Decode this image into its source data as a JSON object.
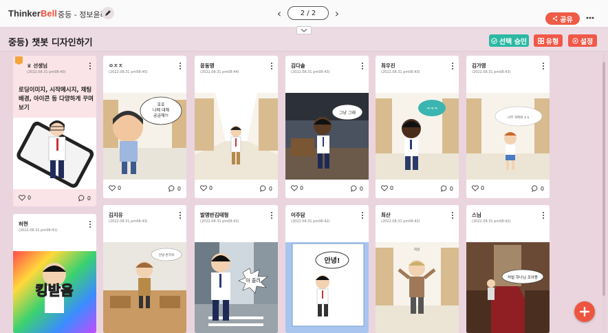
{
  "header": {
    "brand_part1": "Thinker",
    "brand_part2": "Bell",
    "breadcrumb": "중등 - 정보윤리",
    "page_indicator": "2 / 2",
    "share_label": "공유"
  },
  "board": {
    "title": "중등) 챗봇 디자인하기",
    "approve_label": "선택 승인",
    "type_label": "유형",
    "settings_label": "설정"
  },
  "teacher_card": {
    "author": "선생님",
    "date": "(2022.08.31 pm08:40)",
    "prompt": "로딩이미지, 시작메시지, 채팅배경, 아이콘 등 다양하게 꾸며보기",
    "likes": "0",
    "comments": "0"
  },
  "row1": [
    {
      "author": "ㅇㅈㅈ",
      "date": "(2022.08.31 pm08:45)",
      "likes": "0",
      "comments": "0",
      "bubble": "호호\n나에 대해\n궁금해?!"
    },
    {
      "author": "윤동영",
      "date": "(2022.08.31 pm08:44)",
      "likes": "0",
      "comments": "0",
      "bubble": ""
    },
    {
      "author": "김다솔",
      "date": "(2022.08.31 pm08:43)",
      "likes": "0",
      "comments": "0",
      "bubble": "그냥 그래"
    },
    {
      "author": "최우진",
      "date": "(2022.08.31 pm08:43)",
      "likes": "0",
      "comments": "0",
      "bubble": "ㅋㅋㅋ"
    },
    {
      "author": "김가영",
      "date": "(2022.08.31 pm08:43)",
      "likes": "0",
      "comments": "0",
      "bubble": "너무 귀여워 ㅎㅎ"
    }
  ],
  "row2": [
    {
      "author": "허현",
      "date": "(2022.08.31 pm08:41)",
      "big_text": "킹받음"
    },
    {
      "author": "김지유",
      "date": "(2022.08.31 pm08:43)",
      "bubble": "안녕 반가워"
    },
    {
      "author": "발명반김태형",
      "date": "(2022.08.31 pm08:42)",
      "bubble": "아 졸려"
    },
    {
      "author": "이주담",
      "date": "(2022.08.31 pm08:42)",
      "bubble": "안녕!"
    },
    {
      "author": "최산",
      "date": "(2022.08.31 pm08:42)",
      "bubble": "하암"
    },
    {
      "author": "스님",
      "date": "(2022.08.31 pm08:42)",
      "bubble": "허벌 하나님 조아용"
    }
  ],
  "colors": {
    "accent_red": "#ee5b46",
    "approve_green": "#2bb9a3",
    "board_bg": "#ead5df"
  }
}
